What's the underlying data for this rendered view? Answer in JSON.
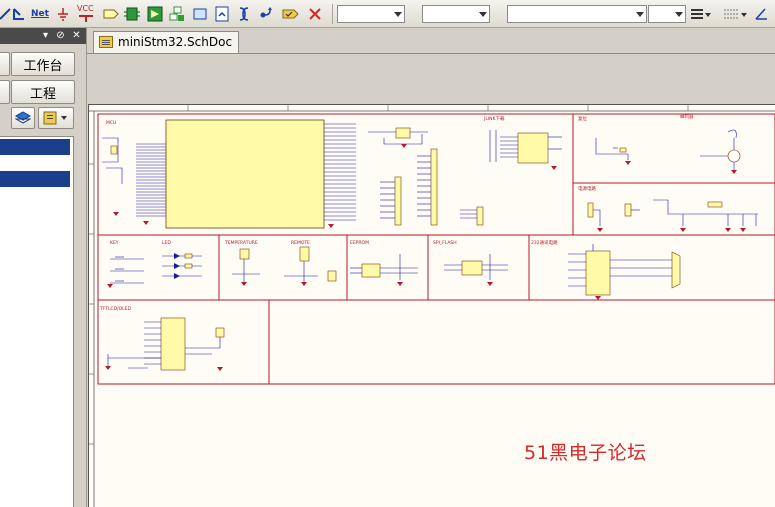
{
  "toolbar": {
    "icons": [
      "wire-icon",
      "net-label-icon",
      "ground-power-icon",
      "vcc-power-icon",
      "bus-icon",
      "part-icon",
      "harness-icon",
      "sheet-symbol-icon",
      "sheet-entry-icon",
      "port-icon",
      "device-sheet-icon",
      "off-sheet-icon",
      "no-erc-icon",
      "directive-icon",
      "delete-icon"
    ],
    "net_text": "Net",
    "vcc_text": "VCC"
  },
  "left_panel": {
    "workbench_label": "工作台",
    "project_label": "工程"
  },
  "document": {
    "tab_label": "miniStm32.SchDoc"
  },
  "schematic": {
    "block_titles": [
      "MCU",
      "JLINK下载",
      "复位",
      "蜂鸣器",
      "电源电路",
      "KEY",
      "LED",
      "TEMPERATURE",
      "REMOTE",
      "EEPROM",
      "SPI_FLASH",
      "232通讯电路",
      "TFTLCD/OLED"
    ],
    "watermark": "51黑电子论坛"
  },
  "colors": {
    "sheet_border": "#b5192a",
    "component_fill": "#fffaa8",
    "wire": "#1a1aa8",
    "watermark": "#d42a2a"
  }
}
